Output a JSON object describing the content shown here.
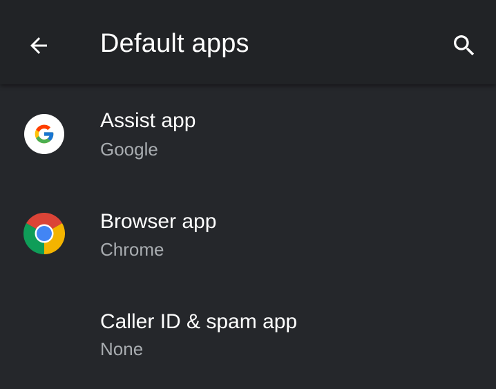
{
  "app_bar": {
    "title": "Default apps",
    "back_icon": "arrow-back-icon",
    "search_icon": "search-icon"
  },
  "items": [
    {
      "title": "Assist app",
      "subtitle": "Google",
      "icon": "google-icon"
    },
    {
      "title": "Browser app",
      "subtitle": "Chrome",
      "icon": "chrome-icon"
    },
    {
      "title": "Caller ID & spam app",
      "subtitle": "None",
      "icon": ""
    }
  ],
  "colors": {
    "background": "#25272b",
    "app_bar": "#212326",
    "primary_text": "#ffffff",
    "secondary_text": "#a8acb0"
  }
}
